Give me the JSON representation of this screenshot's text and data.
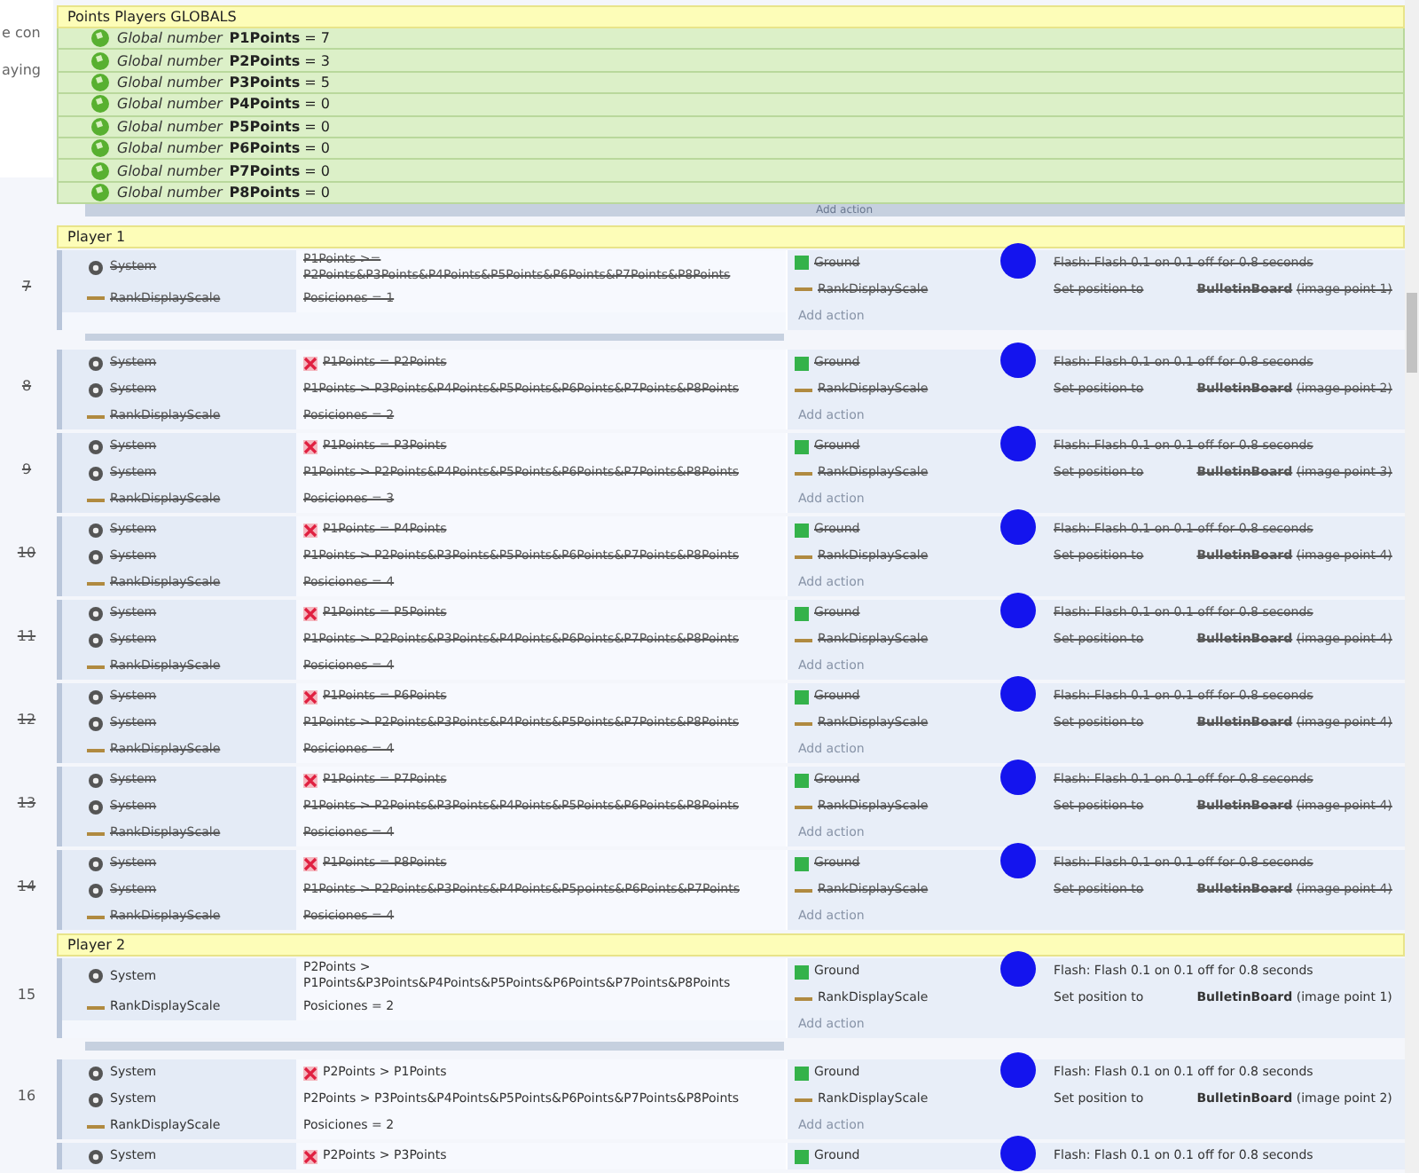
{
  "background_window": {
    "lines": [
      "e con",
      "aying"
    ]
  },
  "globals_group": {
    "title": "Points Players GLOBALS",
    "variables": [
      {
        "kind_label": "Global number",
        "name": "P1Points",
        "value": "= 7"
      },
      {
        "kind_label": "Global number",
        "name": "P2Points",
        "value": "= 3"
      },
      {
        "kind_label": "Global number",
        "name": "P3Points",
        "value": "= 5"
      },
      {
        "kind_label": "Global number",
        "name": "P4Points",
        "value": "= 0"
      },
      {
        "kind_label": "Global number",
        "name": "P5Points",
        "value": "= 0"
      },
      {
        "kind_label": "Global number",
        "name": "P6Points",
        "value": "= 0"
      },
      {
        "kind_label": "Global number",
        "name": "P7Points",
        "value": "= 0"
      },
      {
        "kind_label": "Global number",
        "name": "P8Points",
        "value": "= 0"
      }
    ],
    "add_action": "Add action"
  },
  "groups": [
    {
      "title": "Player 1",
      "events": [
        {
          "number": "7",
          "disabled": true,
          "marked": true,
          "separator_bar": true,
          "conditions": [
            {
              "object": "System",
              "kind": "system",
              "inverted": false,
              "text": "P1Points >= P2Points&P3Points&P4Points&P5Points&P6Points&P7Points&P8Points"
            },
            {
              "object": "RankDisplayScale",
              "kind": "sprite",
              "inverted": false,
              "text": "Posiciones = 1"
            }
          ],
          "actions": [
            {
              "object": "Ground",
              "kind": "tiled",
              "text": "Flash: Flash 0.1 on 0.1 off for 0.8 seconds"
            },
            {
              "object": "RankDisplayScale",
              "kind": "sprite",
              "text": "Set position to",
              "target": "BulletinBoard",
              "detail": "(image point 1)"
            }
          ],
          "add_action": "Add action"
        },
        {
          "number": "8",
          "disabled": true,
          "marked": true,
          "separator_bar": false,
          "conditions": [
            {
              "object": "System",
              "kind": "system",
              "inverted": true,
              "text": "P1Points = P2Points"
            },
            {
              "object": "System",
              "kind": "system",
              "inverted": false,
              "text": "P1Points > P3Points&P4Points&P5Points&P6Points&P7Points&P8Points"
            },
            {
              "object": "RankDisplayScale",
              "kind": "sprite",
              "inverted": false,
              "text": "Posiciones = 2"
            }
          ],
          "actions": [
            {
              "object": "Ground",
              "kind": "tiled",
              "text": "Flash: Flash 0.1 on 0.1 off for 0.8 seconds"
            },
            {
              "object": "RankDisplayScale",
              "kind": "sprite",
              "text": "Set position to",
              "target": "BulletinBoard",
              "detail": "(image point 2)"
            }
          ],
          "add_action": "Add action"
        },
        {
          "number": "9",
          "disabled": true,
          "marked": true,
          "separator_bar": false,
          "conditions": [
            {
              "object": "System",
              "kind": "system",
              "inverted": true,
              "text": "P1Points = P3Points"
            },
            {
              "object": "System",
              "kind": "system",
              "inverted": false,
              "text": "P1Points > P2Points&P4Points&P5Points&P6Points&P7Points&P8Points"
            },
            {
              "object": "RankDisplayScale",
              "kind": "sprite",
              "inverted": false,
              "text": "Posiciones = 3"
            }
          ],
          "actions": [
            {
              "object": "Ground",
              "kind": "tiled",
              "text": "Flash: Flash 0.1 on 0.1 off for 0.8 seconds"
            },
            {
              "object": "RankDisplayScale",
              "kind": "sprite",
              "text": "Set position to",
              "target": "BulletinBoard",
              "detail": "(image point 3)"
            }
          ],
          "add_action": "Add action"
        },
        {
          "number": "10",
          "disabled": true,
          "marked": true,
          "separator_bar": false,
          "conditions": [
            {
              "object": "System",
              "kind": "system",
              "inverted": true,
              "text": "P1Points = P4Points"
            },
            {
              "object": "System",
              "kind": "system",
              "inverted": false,
              "text": "P1Points > P2Points&P3Points&P5Points&P6Points&P7Points&P8Points"
            },
            {
              "object": "RankDisplayScale",
              "kind": "sprite",
              "inverted": false,
              "text": "Posiciones = 4"
            }
          ],
          "actions": [
            {
              "object": "Ground",
              "kind": "tiled",
              "text": "Flash: Flash 0.1 on 0.1 off for 0.8 seconds"
            },
            {
              "object": "RankDisplayScale",
              "kind": "sprite",
              "text": "Set position to",
              "target": "BulletinBoard",
              "detail": "(image point 4)"
            }
          ],
          "add_action": "Add action"
        },
        {
          "number": "11",
          "disabled": true,
          "marked": true,
          "separator_bar": false,
          "conditions": [
            {
              "object": "System",
              "kind": "system",
              "inverted": true,
              "text": "P1Points = P5Points"
            },
            {
              "object": "System",
              "kind": "system",
              "inverted": false,
              "text": "P1Points > P2Points&P3Points&P4Points&P6Points&P7Points&P8Points"
            },
            {
              "object": "RankDisplayScale",
              "kind": "sprite",
              "inverted": false,
              "text": "Posiciones = 4"
            }
          ],
          "actions": [
            {
              "object": "Ground",
              "kind": "tiled",
              "text": "Flash: Flash 0.1 on 0.1 off for 0.8 seconds"
            },
            {
              "object": "RankDisplayScale",
              "kind": "sprite",
              "text": "Set position to",
              "target": "BulletinBoard",
              "detail": "(image point 4)"
            }
          ],
          "add_action": "Add action"
        },
        {
          "number": "12",
          "disabled": true,
          "marked": true,
          "separator_bar": false,
          "conditions": [
            {
              "object": "System",
              "kind": "system",
              "inverted": true,
              "text": "P1Points = P6Points"
            },
            {
              "object": "System",
              "kind": "system",
              "inverted": false,
              "text": "P1Points > P2Points&P3Points&P4Points&P5Points&P7Points&P8Points"
            },
            {
              "object": "RankDisplayScale",
              "kind": "sprite",
              "inverted": false,
              "text": "Posiciones = 4"
            }
          ],
          "actions": [
            {
              "object": "Ground",
              "kind": "tiled",
              "text": "Flash: Flash 0.1 on 0.1 off for 0.8 seconds"
            },
            {
              "object": "RankDisplayScale",
              "kind": "sprite",
              "text": "Set position to",
              "target": "BulletinBoard",
              "detail": "(image point 4)"
            }
          ],
          "add_action": "Add action"
        },
        {
          "number": "13",
          "disabled": true,
          "marked": true,
          "separator_bar": false,
          "conditions": [
            {
              "object": "System",
              "kind": "system",
              "inverted": true,
              "text": "P1Points = P7Points"
            },
            {
              "object": "System",
              "kind": "system",
              "inverted": false,
              "text": "P1Points > P2Points&P3Points&P4Points&P5Points&P6Points&P8Points"
            },
            {
              "object": "RankDisplayScale",
              "kind": "sprite",
              "inverted": false,
              "text": "Posiciones = 4"
            }
          ],
          "actions": [
            {
              "object": "Ground",
              "kind": "tiled",
              "text": "Flash: Flash 0.1 on 0.1 off for 0.8 seconds"
            },
            {
              "object": "RankDisplayScale",
              "kind": "sprite",
              "text": "Set position to",
              "target": "BulletinBoard",
              "detail": "(image point 4)"
            }
          ],
          "add_action": "Add action"
        },
        {
          "number": "14",
          "disabled": true,
          "marked": true,
          "separator_bar": false,
          "conditions": [
            {
              "object": "System",
              "kind": "system",
              "inverted": true,
              "text": "P1Points = P8Points"
            },
            {
              "object": "System",
              "kind": "system",
              "inverted": false,
              "text": "P1Points > P2Points&P3Points&P4Points&P5points&P6Points&P7Points"
            },
            {
              "object": "RankDisplayScale",
              "kind": "sprite",
              "inverted": false,
              "text": "Posiciones = 4"
            }
          ],
          "actions": [
            {
              "object": "Ground",
              "kind": "tiled",
              "text": "Flash: Flash 0.1 on 0.1 off for 0.8 seconds"
            },
            {
              "object": "RankDisplayScale",
              "kind": "sprite",
              "text": "Set position to",
              "target": "BulletinBoard",
              "detail": "(image point 4)"
            }
          ],
          "add_action": "Add action"
        }
      ]
    },
    {
      "title": "Player 2",
      "events": [
        {
          "number": "15",
          "disabled": false,
          "marked": true,
          "separator_bar": true,
          "conditions": [
            {
              "object": "System",
              "kind": "system",
              "inverted": false,
              "text": "P2Points > P1Points&P3Points&P4Points&P5Points&P6Points&P7Points&P8Points"
            },
            {
              "object": "RankDisplayScale",
              "kind": "sprite",
              "inverted": false,
              "text": "Posiciones = 2"
            }
          ],
          "actions": [
            {
              "object": "Ground",
              "kind": "tiled",
              "text": "Flash: Flash 0.1 on 0.1 off for 0.8 seconds"
            },
            {
              "object": "RankDisplayScale",
              "kind": "sprite",
              "text": "Set position to",
              "target": "BulletinBoard",
              "detail": "(image point 1)"
            }
          ],
          "add_action": "Add action"
        },
        {
          "number": "16",
          "disabled": false,
          "marked": true,
          "separator_bar": false,
          "conditions": [
            {
              "object": "System",
              "kind": "system",
              "inverted": true,
              "text": "P2Points > P1Points"
            },
            {
              "object": "System",
              "kind": "system",
              "inverted": false,
              "text": "P2Points > P3Points&P4Points&P5Points&P6Points&P7Points&P8Points"
            },
            {
              "object": "RankDisplayScale",
              "kind": "sprite",
              "inverted": false,
              "text": "Posiciones = 2"
            }
          ],
          "actions": [
            {
              "object": "Ground",
              "kind": "tiled",
              "text": "Flash: Flash 0.1 on 0.1 off for 0.8 seconds"
            },
            {
              "object": "RankDisplayScale",
              "kind": "sprite",
              "text": "Set position to",
              "target": "BulletinBoard",
              "detail": "(image point 2)"
            }
          ],
          "add_action": "Add action"
        },
        {
          "disabled": false,
          "marked": true,
          "separator_bar": false,
          "conditions": [
            {
              "object": "System",
              "kind": "system",
              "inverted": true,
              "text": "P2Points > P3Points"
            }
          ],
          "actions": [
            {
              "object": "Ground",
              "kind": "tiled",
              "text": "Flash: Flash 0.1 on 0.1 off for 0.8 seconds"
            }
          ]
        }
      ]
    }
  ]
}
